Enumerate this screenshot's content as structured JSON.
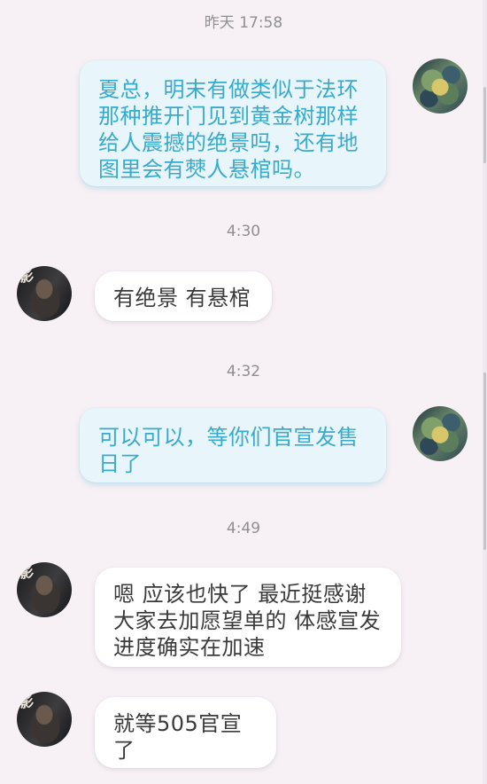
{
  "messages": [
    {
      "timestamp": "昨天 17:58",
      "sender": "self",
      "avatar_icon": "blurred-avatar-icon",
      "text": "夏总，明末有做类似于法环那种推开门见到黄金树那样给人震撼的绝景吗，还有地图里会有僰人悬棺吗。"
    },
    {
      "timestamp": "4:30",
      "sender": "other",
      "avatar_icon": "warrior-avatar-icon",
      "text": "有绝景  有悬棺"
    },
    {
      "timestamp": "4:32",
      "sender": "self",
      "avatar_icon": "blurred-avatar-icon",
      "text": "可以可以，等你们官宣发售日了"
    },
    {
      "timestamp": "4:49",
      "sender": "other",
      "avatar_icon": "warrior-avatar-icon",
      "text": "嗯 应该也快了  最近挺感谢大家去加愿望单的   体感宣发进度确实在加速"
    },
    {
      "timestamp": "",
      "sender": "other",
      "avatar_icon": "warrior-avatar-icon",
      "text": "就等505官宣了"
    }
  ],
  "avatar_glyph": "影",
  "colors": {
    "background": "#f7f0f5",
    "outgoing_bubble": "#e8f5fb",
    "outgoing_text": "#38aacb",
    "incoming_bubble": "#ffffff",
    "incoming_text": "#3a3a3a",
    "timestamp_text": "#8f8f8f"
  }
}
